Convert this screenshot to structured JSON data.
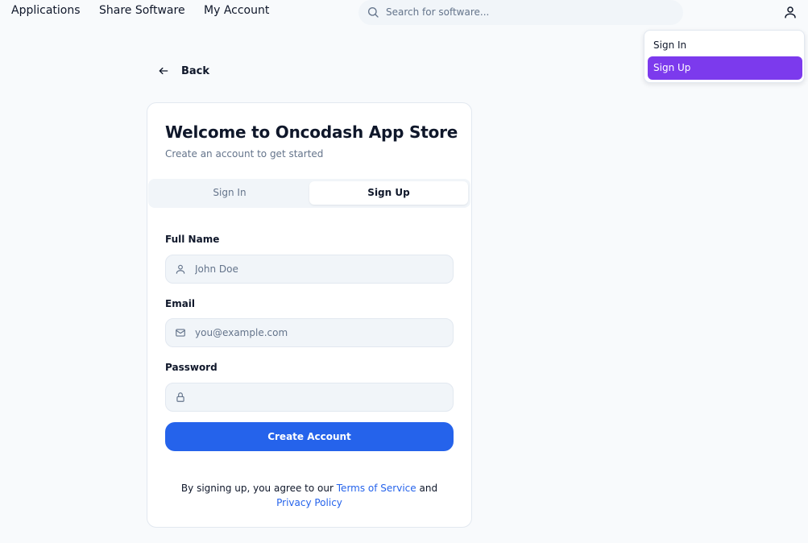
{
  "nav": {
    "links": [
      "Applications",
      "Share Software",
      "My Account"
    ],
    "search_placeholder": "Search for software..."
  },
  "user_menu": {
    "items": [
      "Sign In",
      "Sign Up"
    ],
    "active": "Sign Up"
  },
  "back_label": "Back",
  "card": {
    "title": "Welcome to Oncodash App Store",
    "subtitle": "Create an account to get started",
    "tabs": [
      "Sign In",
      "Sign Up"
    ],
    "active_tab": "Sign Up",
    "full_name": {
      "label": "Full Name",
      "placeholder": "John Doe",
      "value": ""
    },
    "email": {
      "label": "Email",
      "placeholder": "you@example.com",
      "value": ""
    },
    "password": {
      "label": "Password",
      "placeholder": "",
      "value": ""
    },
    "submit_label": "Create Account",
    "terms": {
      "prefix": "By signing up, you agree to our",
      "tos": "Terms of Service",
      "and": "and",
      "privacy": "Privacy Policy"
    }
  },
  "colors": {
    "primary": "#2563eb",
    "menu_active": "#7c3aed",
    "background": "#f8fafc",
    "muted_text": "#64748b"
  }
}
